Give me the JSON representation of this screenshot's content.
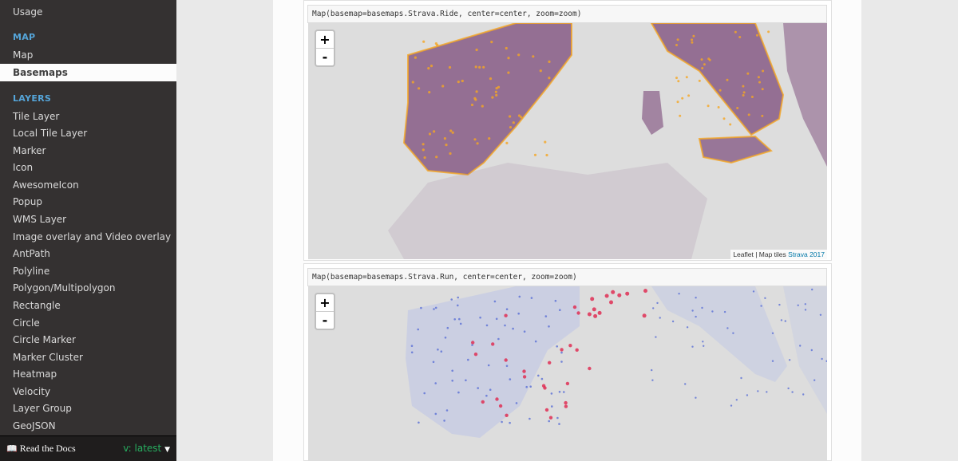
{
  "sidebar": {
    "top_item": "Usage",
    "caption_map": "MAP",
    "map_items": [
      "Map",
      "Basemaps"
    ],
    "caption_layers": "LAYERS",
    "layer_items": [
      "Tile Layer",
      "Local Tile Layer",
      "Marker",
      "Icon",
      "AwesomeIcon",
      "Popup",
      "WMS Layer",
      "Image overlay and Video overlay",
      "AntPath",
      "Polyline",
      "Polygon/Multipolygon",
      "Rectangle",
      "Circle",
      "Circle Marker",
      "Marker Cluster",
      "Heatmap",
      "Velocity",
      "Layer Group",
      "GeoJSON"
    ],
    "current": "Basemaps"
  },
  "rtd": {
    "label": "Read the Docs",
    "version": "v: latest"
  },
  "maps": [
    {
      "code": "Map(basemap=basemaps.Strava.Ride, center=center, zoom=zoom)",
      "zoom_in": "+",
      "zoom_out": "-",
      "attribution_prefix": "Leaflet | Map tiles",
      "attribution_link": "Strava 2017"
    },
    {
      "code": "Map(basemap=basemaps.Strava.Run, center=center, zoom=zoom)",
      "zoom_in": "+",
      "zoom_out": "-"
    }
  ],
  "colors": {
    "sidebar_bg": "#343131",
    "caption": "#55a5d9",
    "version": "#27ae60",
    "ride_route": "#7b4a7a",
    "ride_hot": "#f5a623",
    "run_route": "#5a6fd6",
    "run_hot": "#e0244c"
  },
  "icons": {
    "rtd": "book-icon",
    "version": "caret-down-icon"
  }
}
